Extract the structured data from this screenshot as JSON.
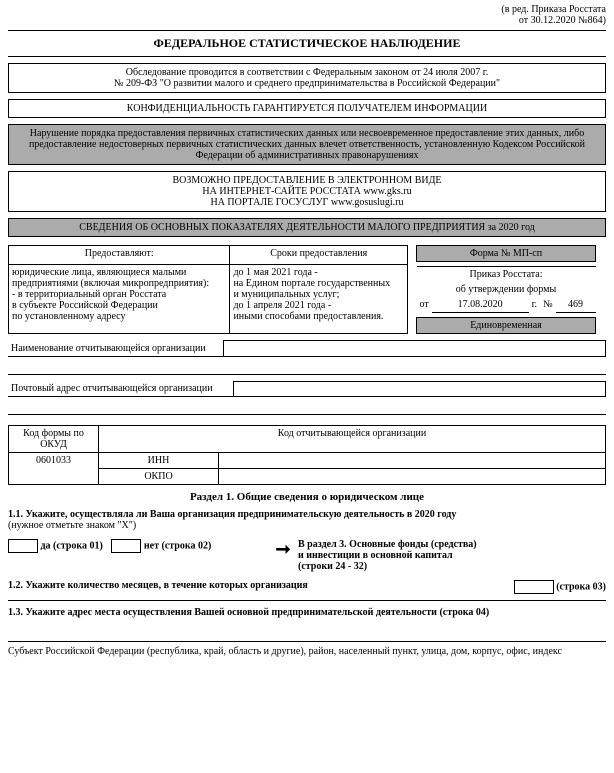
{
  "header_note_line1": "(в ред. Приказа Росстата",
  "header_note_line2": "от 30.12.2020 №864)",
  "main_title": "ФЕДЕРАЛЬНОЕ СТАТИСТИЧЕСКОЕ НАБЛЮДЕНИЕ",
  "survey_box_line1": "Обследование проводится в соответствии с Федеральным законом от 24 июля 2007 г.",
  "survey_box_line2": "№ 209-ФЗ \"О развитии малого и среднего предпринимательства в Российской Федерации\"",
  "confidentiality": "КОНФИДЕНЦИАЛЬНОСТЬ ГАРАНТИРУЕТСЯ ПОЛУЧАТЕЛЕМ ИНФОРМАЦИИ",
  "violation_text": "Нарушение порядка предоставления первичных статистических данных или несвоевременное предоставление этих данных, либо предоставление недостоверных первичных статистических данных влечет ответственность, установленную Кодексом Российской Федерации об административных правонарушениях",
  "electronic_line1": "ВОЗМОЖНО ПРЕДОСТАВЛЕНИЕ В ЭЛЕКТРОННОМ ВИДЕ",
  "electronic_line2": "НА ИНТЕРНЕТ-САЙТЕ РОССТАТА www.gks.ru",
  "electronic_line3": "НА ПОРТАЛЕ ГОСУСЛУГ www.gosuslugi.ru",
  "info_title": "СВЕДЕНИЯ ОБ ОСНОВНЫХ ПОКАЗАТЕЛЯХ ДЕЯТЕЛЬНОСТИ МАЛОГО ПРЕДПРИЯТИЯ за 2020 год",
  "tbl": {
    "col1_h": "Предоставляют:",
    "col2_h": "Сроки предоставления",
    "col1_r1": "юридические лица, являющиеся малыми",
    "col1_r2": "предприятиями (включая микропредприятия):",
    "col1_r3": "  - в территориальный орган Росстата",
    "col1_r4": "в субъекте Российской Федерации",
    "col1_r5": "по установленному адресу",
    "col2_r1": "до 1 мая 2021 года -",
    "col2_r2": "на Едином портале государственных",
    "col2_r3": "и муниципальных услуг;",
    "col2_r4": "до 1 апреля 2021 года -",
    "col2_r5": "иными способами предоставления."
  },
  "formright": {
    "formno": "Форма № МП-сп",
    "order_l1": "Приказ Росстата:",
    "order_l2": "об утверждении формы",
    "from": "от",
    "date": "17.08.2020",
    "g": "г.",
    "no": "№",
    "num": "469",
    "freq": "Единовременная"
  },
  "org_name_label": "Наименование отчитывающейся организации",
  "org_addr_label": "Почтовый адрес отчитывающейся организации",
  "codes": {
    "okud_label": "Код формы по ОКУД",
    "okud_value": "0601033",
    "org_code_label": "Код отчитывающейся организации",
    "inn": "ИНН",
    "okpo": "ОКПО"
  },
  "section1_title": "Раздел 1. Общие сведения о юридическом лице",
  "q11": {
    "text": "1.1. Укажите, осуществляла ли Ваша организация предпринимательскую деятельность в 2020 году",
    "hint": "(нужное отметьте знаком \"Х\")",
    "yes": "да (строка 01)",
    "no": "нет (строка 02)",
    "goto_l1": "В раздел 3. Основные фонды (средства)",
    "goto_l2": "и инвестиции в основной капитал",
    "goto_l3": "(строки 24 - 32)"
  },
  "q12": {
    "text": "1.2. Укажите количество месяцев, в течение которых организация",
    "line03": "(строка 03)"
  },
  "q13": "1.3. Укажите адрес места осуществления Вашей основной предпринимательской деятельности (строка 04)",
  "subject_text": "Субъект Российской Федерации (республика, край, область и другие), район, населенный пункт, улица, дом, корпус, офис, индекс"
}
